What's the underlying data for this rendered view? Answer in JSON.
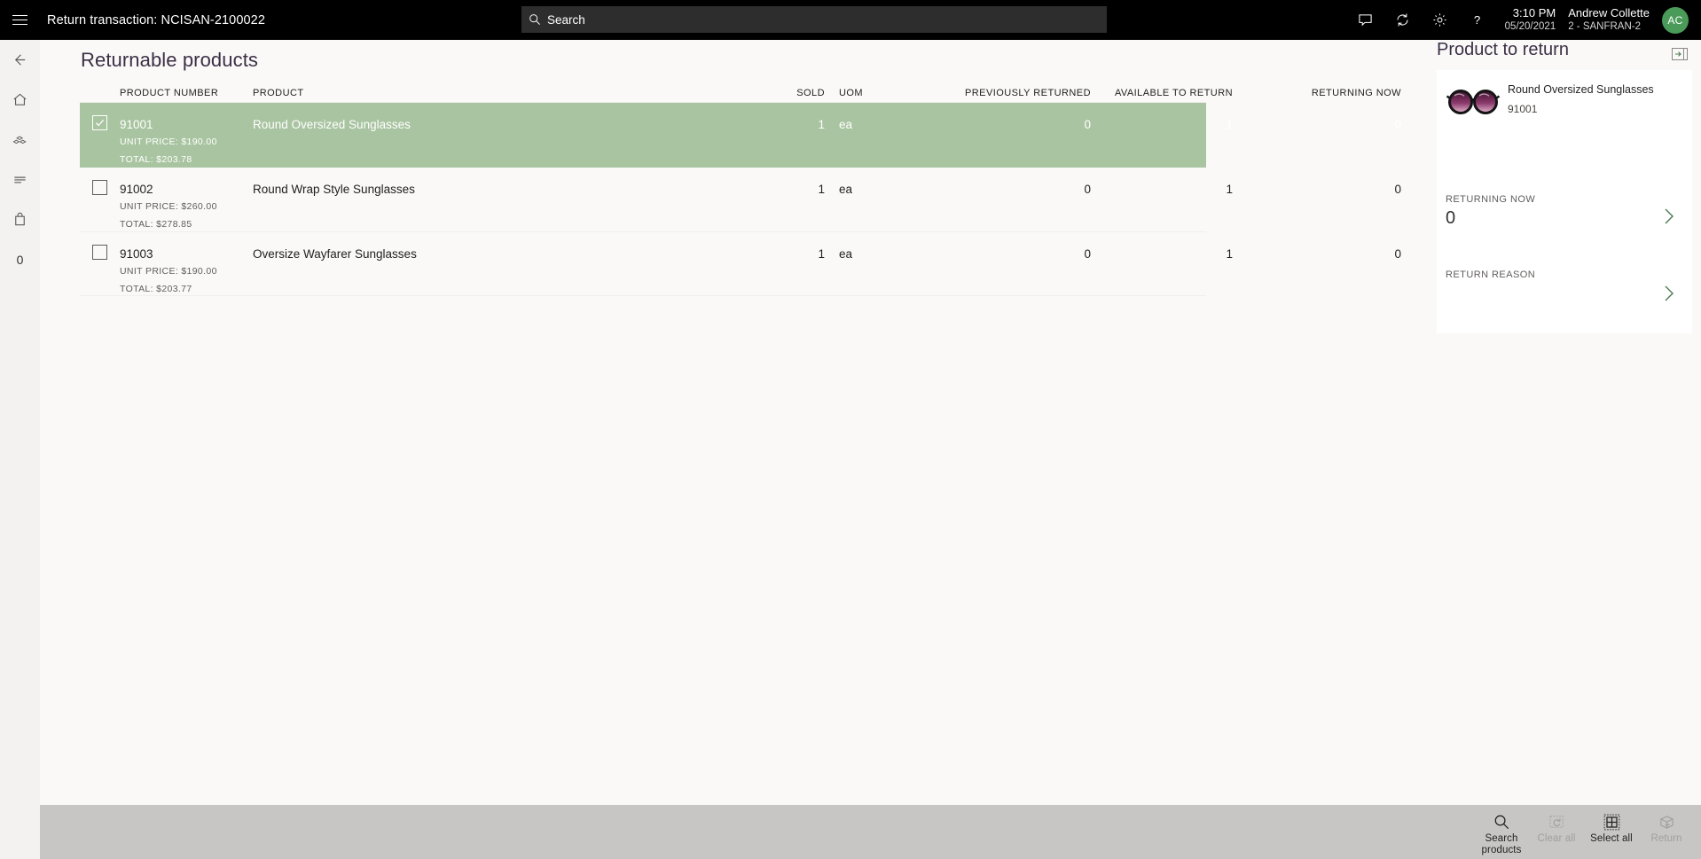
{
  "topbar": {
    "menu_icon": "hamburger-icon",
    "title": "Return transaction: NCISAN-2100022",
    "search": {
      "placeholder": "Search",
      "value": "",
      "icon": "search-icon"
    },
    "icons": [
      "message-icon",
      "sync-icon",
      "gear-icon",
      "help-icon"
    ],
    "time": "3:10 PM",
    "date": "05/20/2021",
    "user_name": "Andrew Collette",
    "user_store": "2 - SANFRAN-2",
    "avatar_initials": "AC",
    "avatar_color": "#4a9b59"
  },
  "rail": {
    "items": [
      {
        "name": "back-icon",
        "label": ""
      },
      {
        "name": "home-icon",
        "label": ""
      },
      {
        "name": "products-icon",
        "label": ""
      },
      {
        "name": "journal-icon",
        "label": ""
      },
      {
        "name": "shopping-bag-icon",
        "label": ""
      },
      {
        "name": "cart-count",
        "label": "0"
      }
    ]
  },
  "main": {
    "page_title": "Returnable products",
    "columns": [
      "PRODUCT NUMBER",
      "PRODUCT",
      "SOLD",
      "UOM",
      "PREVIOUSLY RETURNED",
      "AVAILABLE TO RETURN",
      "RETURNING NOW"
    ],
    "rows": [
      {
        "selected": true,
        "checked": true,
        "product_number": "91001",
        "product": "Round Oversized Sunglasses",
        "unit_price": "UNIT PRICE: $190.00",
        "total": "TOTAL: $203.78",
        "sold": "1",
        "uom": "ea",
        "previously_returned": "0",
        "available_to_return": "1",
        "returning_now": "0"
      },
      {
        "selected": false,
        "checked": false,
        "product_number": "91002",
        "product": "Round Wrap Style Sunglasses",
        "unit_price": "UNIT PRICE: $260.00",
        "total": "TOTAL: $278.85",
        "sold": "1",
        "uom": "ea",
        "previously_returned": "0",
        "available_to_return": "1",
        "returning_now": "0"
      },
      {
        "selected": false,
        "checked": false,
        "product_number": "91003",
        "product": "Oversize Wayfarer Sunglasses",
        "unit_price": "UNIT PRICE: $190.00",
        "total": "TOTAL: $203.77",
        "sold": "1",
        "uom": "ea",
        "previously_returned": "0",
        "available_to_return": "1",
        "returning_now": "0"
      }
    ]
  },
  "right_panel": {
    "title": "Product to return",
    "expand_icon": "panel-expand-icon",
    "product_name": "Round Oversized Sunglasses",
    "product_number": "91001",
    "product_image": "sunglasses-thumbnail",
    "returning_now_label": "RETURNING NOW",
    "returning_now_value": "0",
    "return_reason_label": "RETURN REASON",
    "return_reason_value": ""
  },
  "footer": {
    "commands": [
      {
        "icon": "search-icon",
        "label": "Search products",
        "disabled": false
      },
      {
        "icon": "clear-all-icon",
        "label": "Clear all",
        "disabled": true
      },
      {
        "icon": "select-all-icon",
        "label": "Select all",
        "disabled": false
      },
      {
        "icon": "return-box-icon",
        "label": "Return",
        "disabled": true
      }
    ]
  },
  "colors": {
    "selected_row": "#a9c4a0",
    "topbar": "#000000",
    "footer": "#c8c6c4",
    "accent_title": "#3b2f45",
    "chevron": "#4a7a4f"
  }
}
